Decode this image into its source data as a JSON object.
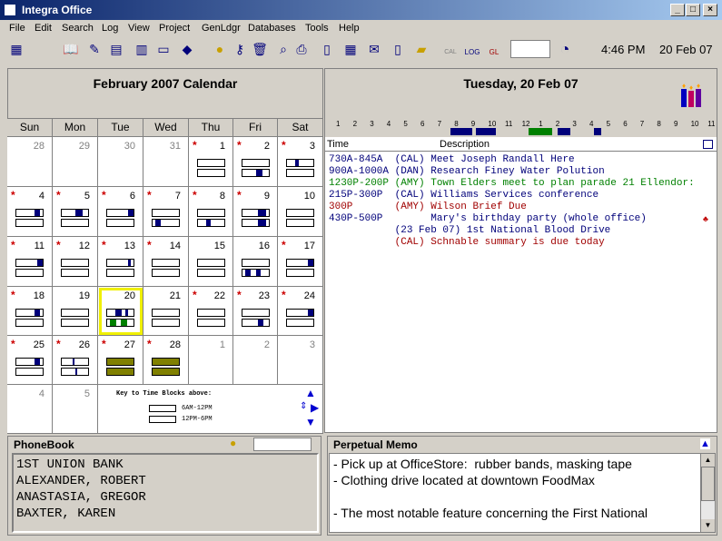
{
  "window": {
    "title": "Integra Office"
  },
  "menu": [
    "File",
    "Edit",
    "Search",
    "Log",
    "View",
    "Project",
    "GenLdgr",
    "Databases",
    "Tools",
    "Help"
  ],
  "toolbar": {
    "time": "4:46 PM",
    "date": "20 Feb 07",
    "cal_label": "CAL",
    "log_label": "LOG",
    "gl_label": "GL"
  },
  "calendar": {
    "title": "February 2007 Calendar",
    "days": [
      "Sun",
      "Mon",
      "Tue",
      "Wed",
      "Thu",
      "Fri",
      "Sat"
    ],
    "weeks": [
      [
        "28",
        "29",
        "30",
        "31",
        "1",
        "2",
        "3"
      ],
      [
        "4",
        "5",
        "6",
        "7",
        "8",
        "9",
        "10"
      ],
      [
        "11",
        "12",
        "13",
        "14",
        "15",
        "16",
        "17"
      ],
      [
        "18",
        "19",
        "20",
        "21",
        "22",
        "23",
        "24"
      ],
      [
        "25",
        "26",
        "27",
        "28",
        "1",
        "2",
        "3"
      ],
      [
        "4",
        "5"
      ]
    ],
    "key_title": "Key to Time Blocks above:",
    "key_am": "6AM-12PM",
    "key_pm": "12PM-6PM"
  },
  "day": {
    "title": "Tuesday, 20 Feb 07",
    "hours": [
      "1",
      "2",
      "3",
      "4",
      "5",
      "6",
      "7",
      "8",
      "9",
      "10",
      "11",
      "12",
      "1",
      "2",
      "3",
      "4",
      "5",
      "6",
      "7",
      "8",
      "9",
      "10",
      "11"
    ],
    "col_time": "Time",
    "col_desc": "Description",
    "events": [
      {
        "time": "730A-845A ",
        "who": "(CAL)",
        "desc": "Meet Joseph Randall Here",
        "color": "#00007a"
      },
      {
        "time": "900A-1000A",
        "who": "(DAN)",
        "desc": "Research Finey Water Polution",
        "color": "#00007a"
      },
      {
        "time": "1230P-200P",
        "who": "(AMY)",
        "desc": "Town Elders meet to plan parade 21 Ellendor:",
        "color": "#008000"
      },
      {
        "time": "215P-300P ",
        "who": "(CAL)",
        "desc": "Williams Services conference",
        "color": "#00007a"
      },
      {
        "time": "300P      ",
        "who": "(AMY)",
        "desc": "Wilson Brief Due",
        "color": "#a00000"
      },
      {
        "time": "430P-500P ",
        "who": "     ",
        "desc": "Mary's birthday party (whole office)",
        "color": "#00007a"
      },
      {
        "time": "          ",
        "who": "(23 Feb 07)",
        "desc": "1st National Blood Drive",
        "color": "#00007a"
      },
      {
        "time": "          ",
        "who": "(CAL)",
        "desc": "Schnable summary is due today",
        "color": "#a00000"
      }
    ]
  },
  "phonebook": {
    "title": "PhoneBook",
    "entries": [
      "1ST UNION BANK",
      "ALEXANDER, ROBERT",
      "ANASTASIA, GREGOR",
      "BAXTER, KAREN"
    ]
  },
  "memo": {
    "title": "Perpetual Memo",
    "lines": [
      "- Pick up at OfficeStore:  rubber bands, masking tape",
      "- Clothing drive located at downtown FoodMax",
      "",
      "- The most notable feature concerning the First National"
    ]
  }
}
